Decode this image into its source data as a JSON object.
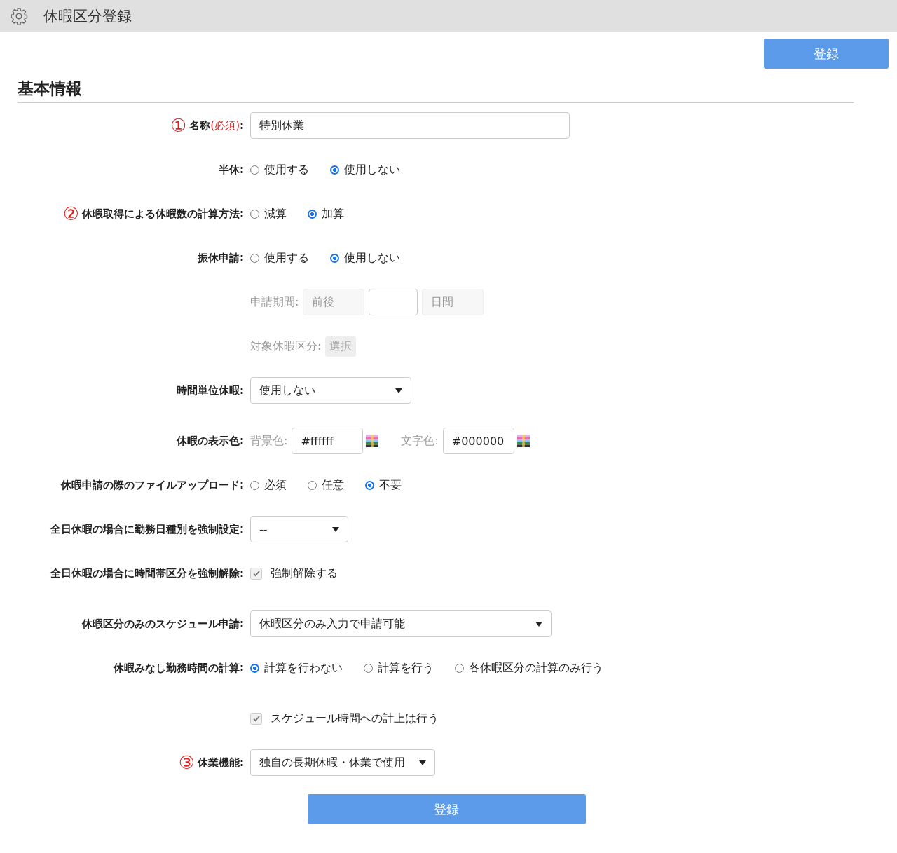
{
  "header": {
    "title": "休暇区分登録"
  },
  "top_button": "登録",
  "section_title": "基本情報",
  "rows": [
    {
      "kind": "text",
      "marker": "①",
      "label": "名称",
      "required": "(必須)",
      "suffix": ":",
      "value": "特別休業"
    },
    {
      "kind": "radio",
      "label": "半休:",
      "options": [
        {
          "label": "使用する",
          "selected": false
        },
        {
          "label": "使用しない",
          "selected": true
        }
      ]
    },
    {
      "kind": "radio",
      "marker": "②",
      "label": "休暇取得による休暇数の計算方法:",
      "options": [
        {
          "label": "減算",
          "selected": false
        },
        {
          "label": "加算",
          "selected": true
        }
      ]
    },
    {
      "kind": "radio",
      "label": "振休申請:",
      "options": [
        {
          "label": "使用する",
          "selected": false
        },
        {
          "label": "使用しない",
          "selected": true
        }
      ]
    },
    {
      "kind": "period",
      "caption": "申請期間:",
      "prefix": "前後",
      "suffix": "日間"
    },
    {
      "kind": "pick",
      "caption": "対象休暇区分:",
      "button": "選択"
    },
    {
      "kind": "select",
      "label": "時間単位休暇:",
      "value": "使用しない"
    },
    {
      "kind": "colors",
      "label": "休暇の表示色:",
      "colors": [
        {
          "caption": "背景色:",
          "value": "#ffffff"
        },
        {
          "caption": "文字色:",
          "value": "#000000"
        }
      ]
    },
    {
      "kind": "radio",
      "label": "休暇申請の際のファイルアップロード:",
      "options": [
        {
          "label": "必須",
          "selected": false
        },
        {
          "label": "任意",
          "selected": false
        },
        {
          "label": "不要",
          "selected": true
        }
      ]
    },
    {
      "kind": "select",
      "label": "全日休暇の場合に勤務日種別を強制設定:",
      "value": "--"
    },
    {
      "kind": "checkbox",
      "label": "全日休暇の場合に時間帯区分を強制解除:",
      "text": "強制解除する",
      "checked": true,
      "disabled": true
    },
    {
      "kind": "select",
      "label": "休暇区分のみのスケジュール申請:",
      "value": "休暇区分のみ入力で申請可能"
    },
    {
      "kind": "radio",
      "label": "休暇みなし勤務時間の計算:",
      "options": [
        {
          "label": "計算を行わない",
          "selected": true
        },
        {
          "label": "計算を行う",
          "selected": false
        },
        {
          "label": "各休暇区分の計算のみ行う",
          "selected": false
        }
      ]
    },
    {
      "kind": "checkbox",
      "text": "スケジュール時間への計上は行う",
      "checked": true,
      "disabled": true
    },
    {
      "kind": "select",
      "marker": "③",
      "label": "休業機能:",
      "value": "独自の長期休暇・休業で使用"
    }
  ],
  "bottom_button": "登録"
}
